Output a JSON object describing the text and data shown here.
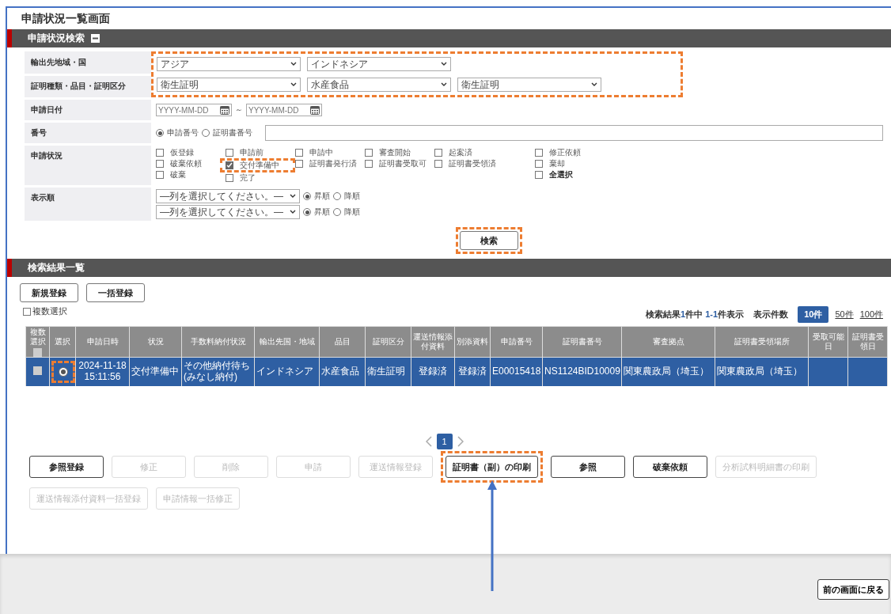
{
  "page_title": "申請状況一覧画面",
  "search": {
    "title": "申請状況検索",
    "expanded": true,
    "destination": {
      "label": "輸出先地域・国",
      "selects": [
        "アジア",
        "インドネシア"
      ]
    },
    "certificate": {
      "label": "証明種類・品目・証明区分",
      "selects": [
        "衛生証明",
        "水産食品",
        "衛生証明"
      ]
    },
    "selects_highlighted": true,
    "date": {
      "label": "申請日付",
      "from_placeholder": "YYYY-MM-DD",
      "separator": "～",
      "to_placeholder": "YYYY-MM-DD"
    },
    "number": {
      "label": "番号",
      "options": [
        {
          "label": "申請番号",
          "selected": true
        },
        {
          "label": "証明書番号",
          "selected": false
        }
      ]
    },
    "status": {
      "label": "申請状況",
      "columns": [
        [
          {
            "label": "仮登録",
            "checked": false,
            "highlighted": false,
            "kind": "status"
          },
          {
            "label": "破棄依頼",
            "checked": false,
            "highlighted": false,
            "kind": "status"
          },
          {
            "label": "破棄",
            "checked": false,
            "highlighted": false,
            "kind": "status"
          }
        ],
        [
          {
            "label": "申請前",
            "checked": false,
            "highlighted": false,
            "kind": "status"
          },
          {
            "label": "交付準備中",
            "checked": true,
            "highlighted": true,
            "kind": "status"
          },
          {
            "label": "完了",
            "checked": false,
            "highlighted": false,
            "kind": "status"
          }
        ],
        [
          {
            "label": "申請中",
            "checked": false,
            "highlighted": false,
            "kind": "status"
          },
          {
            "label": "証明書発行済",
            "checked": false,
            "highlighted": false,
            "kind": "status"
          }
        ],
        [
          {
            "label": "審査開始",
            "checked": false,
            "highlighted": false,
            "kind": "status"
          },
          {
            "label": "証明書受取可",
            "checked": false,
            "highlighted": false,
            "kind": "status"
          }
        ],
        [
          {
            "label": "起案済",
            "checked": false,
            "highlighted": false,
            "kind": "status"
          },
          {
            "label": "証明書受領済",
            "checked": false,
            "highlighted": false,
            "kind": "status"
          }
        ],
        [
          {
            "label": "修正依頼",
            "checked": false,
            "highlighted": false,
            "kind": "status"
          },
          {
            "label": "棄却",
            "checked": false,
            "highlighted": false,
            "kind": "status"
          },
          {
            "label": "全選択",
            "checked": false,
            "highlighted": false,
            "kind": "select_all"
          }
        ]
      ]
    },
    "order": {
      "label": "表示順",
      "rows": [
        {
          "value": "—列を選択してください。—",
          "options": [
            {
              "label": "昇順",
              "selected": true
            },
            {
              "label": "降順",
              "selected": false
            }
          ]
        },
        {
          "value": "—列を選択してください。—",
          "options": [
            {
              "label": "昇順",
              "selected": true
            },
            {
              "label": "降順",
              "selected": false
            }
          ]
        }
      ]
    },
    "search_button": {
      "label": "検索",
      "highlighted": true
    }
  },
  "results": {
    "title": "検索結果一覧",
    "buttons": [
      "新規登録",
      "一括登録"
    ],
    "multi_select": {
      "label": "複数選択",
      "checked": false
    },
    "summary": "検索結果**1**件中 **1-1**件表示",
    "page_size_label": "表示件数",
    "page_sizes": [
      {
        "label": "10件",
        "selected": true
      },
      {
        "label": "50件",
        "selected": false
      },
      {
        "label": "100件",
        "selected": false
      }
    ],
    "header_checked": false,
    "columns": [
      "複数選択",
      "選択",
      "申請日時",
      "状況",
      "手数料納付状況",
      "輸出先国・地域",
      "品目",
      "証明区分",
      "運送情報添付資料",
      "別添資料",
      "申請番号",
      "証明書番号",
      "審査拠点",
      "証明書受領場所",
      "受取可能日",
      "証明書受領日"
    ],
    "rows": [
      {
        "checked": false,
        "selected": true,
        "highlighted": true,
        "cells": [
          "",
          "",
          "2024-11-18\n15:11:56",
          "交付準備中",
          "その他納付待ち(みなし納付)",
          "インドネシア",
          "水産食品",
          "衛生証明",
          "登録済",
          "登録済",
          "E00015418",
          "NS1124BID10009",
          "関東農政局（埼玉）",
          "関東農政局（埼玉）",
          "",
          ""
        ]
      }
    ]
  },
  "pagination": {
    "pages": [
      {
        "label": "1",
        "selected": true
      }
    ]
  },
  "actions": [
    {
      "label": "参照登録",
      "disabled": false,
      "highlighted": false,
      "pointed": false
    },
    {
      "label": "修正",
      "disabled": true,
      "highlighted": false,
      "pointed": false
    },
    {
      "label": "削除",
      "disabled": true,
      "highlighted": false,
      "pointed": false
    },
    {
      "label": "申請",
      "disabled": true,
      "highlighted": false,
      "pointed": false
    },
    {
      "label": "運送情報登録",
      "disabled": true,
      "highlighted": false,
      "pointed": false
    },
    {
      "label": "証明書（副）の印刷",
      "disabled": false,
      "highlighted": true,
      "pointed": true
    },
    {
      "label": "参照",
      "disabled": false,
      "highlighted": false,
      "pointed": false
    },
    {
      "label": "破棄依頼",
      "disabled": false,
      "highlighted": false,
      "pointed": false
    },
    {
      "label": "分析試料明細書の印刷",
      "disabled": true,
      "highlighted": false,
      "pointed": false
    },
    {
      "label": "運送情報添付資料一括登録",
      "disabled": true,
      "highlighted": false,
      "pointed": false
    },
    {
      "label": "申請情報一括修正",
      "disabled": true,
      "highlighted": false,
      "pointed": false
    }
  ],
  "back_button": "前の画面に戻る"
}
